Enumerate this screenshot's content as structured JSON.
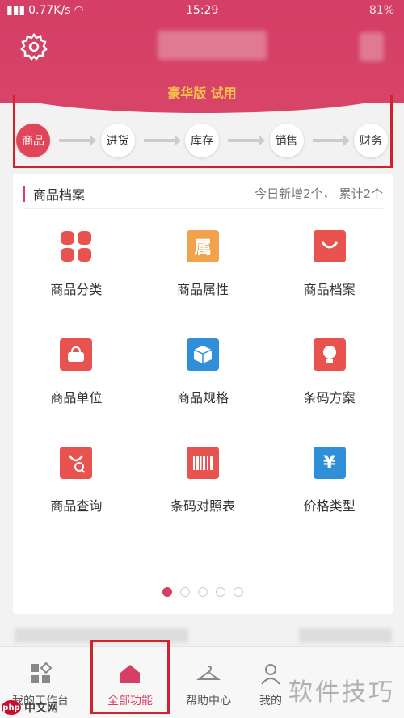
{
  "status_bar": {
    "network": "0.77K/s",
    "time": "15:29",
    "right": "81%"
  },
  "header": {
    "edition": "豪华版 试用"
  },
  "flow": [
    "商品",
    "进货",
    "库存",
    "销售",
    "财务"
  ],
  "card": {
    "title": "商品档案",
    "stat": "今日新增2个， 累计2个",
    "tiles": [
      {
        "label": "商品分类",
        "icon": "four-squares-icon",
        "color": "#e8534f"
      },
      {
        "label": "商品属性",
        "icon": "shu-character-icon",
        "color": "#f2a24a",
        "glyph": "属"
      },
      {
        "label": "商品档案",
        "icon": "shopping-bag-icon",
        "color": "#e8534f"
      },
      {
        "label": "商品单位",
        "icon": "handbag-icon",
        "color": "#e8534f"
      },
      {
        "label": "商品规格",
        "icon": "box-icon",
        "color": "#2f8fd8"
      },
      {
        "label": "条码方案",
        "icon": "bulb-icon",
        "color": "#e8534f"
      },
      {
        "label": "商品查询",
        "icon": "bag-search-icon",
        "color": "#e8534f"
      },
      {
        "label": "条码对照表",
        "icon": "barcode-icon",
        "color": "#e8534f"
      },
      {
        "label": "价格类型",
        "icon": "yen-icon",
        "color": "#2f8fd8",
        "glyph": "¥"
      }
    ],
    "pages": 5,
    "current_page": 1
  },
  "tabbar": {
    "tabs": [
      {
        "label": "我的工作台"
      },
      {
        "label": "全部功能"
      },
      {
        "label": "帮助中心"
      },
      {
        "label": "我的"
      }
    ],
    "active": 1
  },
  "watermark": {
    "text": "软件技巧",
    "logo_php": "php",
    "logo_cn": "中文网"
  },
  "colors": {
    "brand": "#d53f65",
    "highlight": "#d2212f",
    "accent_yellow": "#f6c24a"
  }
}
